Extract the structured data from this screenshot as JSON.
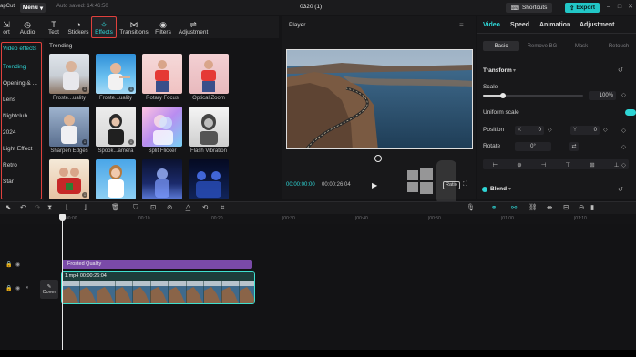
{
  "app": {
    "logo_text": "apCut",
    "menu_label": "Menu",
    "autosave": "Auto saved: 14:46:50",
    "project_title": "0320 (1)",
    "shortcuts_label": "Shortcuts",
    "export_label": "Export"
  },
  "toolbar": {
    "tabs": [
      {
        "label": "ort",
        "icon": "import-icon"
      },
      {
        "label": "Audio",
        "icon": "audio-icon"
      },
      {
        "label": "Text",
        "icon": "text-icon"
      },
      {
        "label": "Stickers",
        "icon": "stickers-icon"
      },
      {
        "label": "Effects",
        "icon": "effects-icon",
        "active": true
      },
      {
        "label": "Transitions",
        "icon": "transitions-icon"
      },
      {
        "label": "Filters",
        "icon": "filters-icon"
      },
      {
        "label": "Adjustment",
        "icon": "adjustment-icon"
      }
    ]
  },
  "sidebar": {
    "header": "Video effects",
    "items": [
      "Trending",
      "Opening & ...",
      "Lens",
      "Nightclub",
      "2024",
      "Light Effect",
      "Retro",
      "Star"
    ]
  },
  "effects": {
    "section_title": "Trending",
    "items": [
      {
        "label": "Froste...uality"
      },
      {
        "label": "Froste...uality"
      },
      {
        "label": "Rotary Focus"
      },
      {
        "label": "Optical Zoom"
      },
      {
        "label": "Sharpen Edges"
      },
      {
        "label": "Spook...amera"
      },
      {
        "label": "Split Flicker"
      },
      {
        "label": "Flash Vibration"
      },
      {
        "label": ""
      },
      {
        "label": ""
      },
      {
        "label": ""
      },
      {
        "label": ""
      }
    ]
  },
  "player": {
    "title": "Player",
    "current_time": "00:00:00:00",
    "total_time": "00:00:26:04",
    "ratio_label": "Ratio"
  },
  "inspector": {
    "tabs": [
      "Video",
      "Speed",
      "Animation",
      "Adjustment"
    ],
    "subtabs": [
      "Basic",
      "Remove BG",
      "Mask",
      "Retouch"
    ],
    "transform_label": "Transform",
    "scale_label": "Scale",
    "scale_value": "100%",
    "scale_level": 0.2,
    "uniform_scale_label": "Uniform scale",
    "position_label": "Position",
    "position_x_axis": "X",
    "position_x": "0",
    "position_y_axis": "Y",
    "position_y": "0",
    "rotate_label": "Rotate",
    "rotate_value": "0°",
    "blend_label": "Blend"
  },
  "timeline": {
    "ruler_labels": [
      "00:00",
      "00:10",
      "00:20",
      "|00:30",
      "|00:40",
      "|00:50",
      "|01:00",
      "|01:10"
    ],
    "effect_clip_label": "Frosted Quality",
    "video_clip_label": "1.mp4  00:00:26:04",
    "cover_label": "Cover"
  },
  "colors": {
    "accent": "#2fd5d5",
    "highlight_red": "#e0413d",
    "effect_clip": "#7a4aa8",
    "video_clip_border": "#3fe0d0"
  }
}
